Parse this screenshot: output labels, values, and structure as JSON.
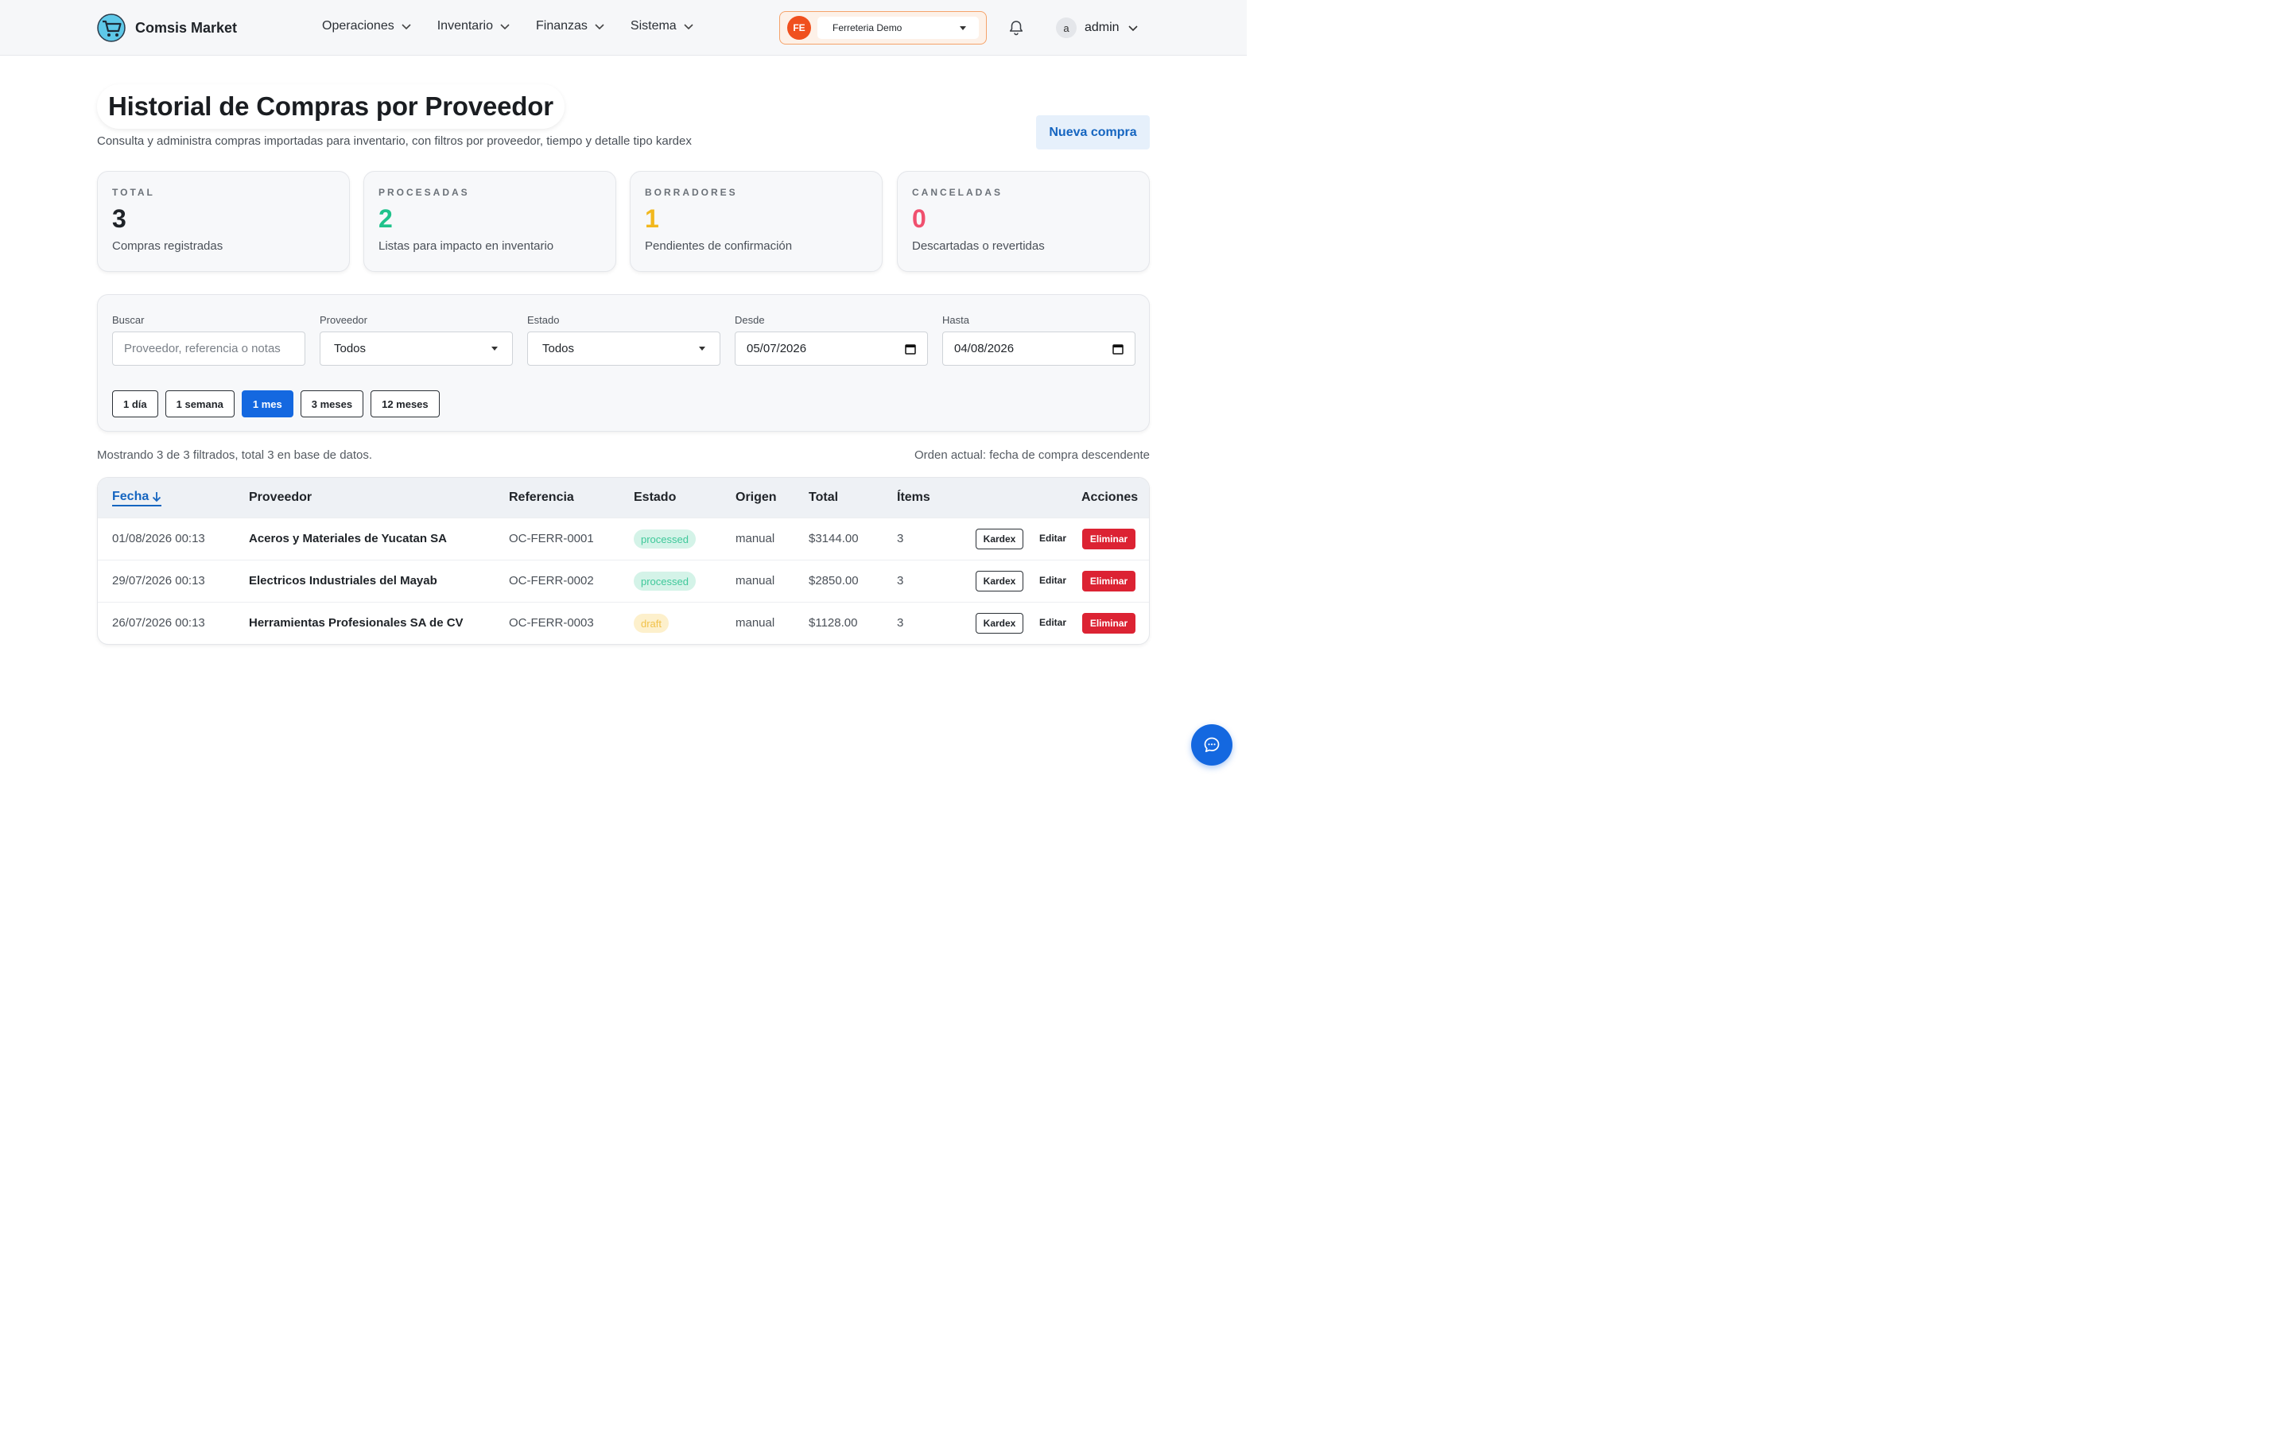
{
  "header": {
    "brand": "Comsis Market",
    "nav": [
      "Operaciones",
      "Inventario",
      "Finanzas",
      "Sistema"
    ],
    "store_badge": "FE",
    "store_name": "Ferreteria Demo",
    "user_initial": "a",
    "user_name": "admin"
  },
  "page": {
    "title": "Historial de Compras por Proveedor",
    "subtitle": "Consulta y administra compras importadas para inventario, con filtros por proveedor, tiempo y detalle tipo kardex",
    "new_button": "Nueva compra"
  },
  "stats": [
    {
      "label": "TOTAL",
      "value": "3",
      "desc": "Compras registradas",
      "color": "#1f2328"
    },
    {
      "label": "PROCESADAS",
      "value": "2",
      "desc": "Listas para impacto en inventario",
      "color": "#1fc28b"
    },
    {
      "label": "BORRADORES",
      "value": "1",
      "desc": "Pendientes de confirmación",
      "color": "#f2b81e"
    },
    {
      "label": "CANCELADAS",
      "value": "0",
      "desc": "Descartadas o revertidas",
      "color": "#f0506e"
    }
  ],
  "filters": {
    "search_label": "Buscar",
    "search_placeholder": "Proveedor, referencia o notas",
    "provider_label": "Proveedor",
    "provider_value": "Todos",
    "status_label": "Estado",
    "status_value": "Todos",
    "from_label": "Desde",
    "from_value": "05/07/2026",
    "to_label": "Hasta",
    "to_value": "04/08/2026",
    "ranges": [
      "1 día",
      "1 semana",
      "1 mes",
      "3 meses",
      "12 meses"
    ],
    "active_range": "1 mes"
  },
  "summary": {
    "showing": "Mostrando 3 de 3 filtrados, total 3 en base de datos.",
    "order": "Orden actual: fecha de compra descendente"
  },
  "table": {
    "headers": {
      "date": "Fecha",
      "provider": "Proveedor",
      "reference": "Referencia",
      "status": "Estado",
      "origin": "Origen",
      "total": "Total",
      "items": "Ítems",
      "actions": "Acciones"
    },
    "actions": {
      "kardex": "Kardex",
      "edit": "Editar",
      "delete": "Eliminar"
    },
    "rows": [
      {
        "date": "01/08/2026 00:13",
        "provider": "Aceros y Materiales de Yucatan SA",
        "reference": "OC-FERR-0001",
        "status": "processed",
        "origin": "manual",
        "total": "$3144.00",
        "items": "3"
      },
      {
        "date": "29/07/2026 00:13",
        "provider": "Electricos Industriales del Mayab",
        "reference": "OC-FERR-0002",
        "status": "processed",
        "origin": "manual",
        "total": "$2850.00",
        "items": "3"
      },
      {
        "date": "26/07/2026 00:13",
        "provider": "Herramientas Profesionales SA de CV",
        "reference": "OC-FERR-0003",
        "status": "draft",
        "origin": "manual",
        "total": "$1128.00",
        "items": "3"
      }
    ]
  },
  "icons": {
    "logo": "shopping-cart-icon",
    "chevron": "chevron-down-icon",
    "bell": "bell-icon",
    "calendar": "calendar-icon",
    "chat": "chat-icon",
    "sort": "arrow-down-icon"
  }
}
